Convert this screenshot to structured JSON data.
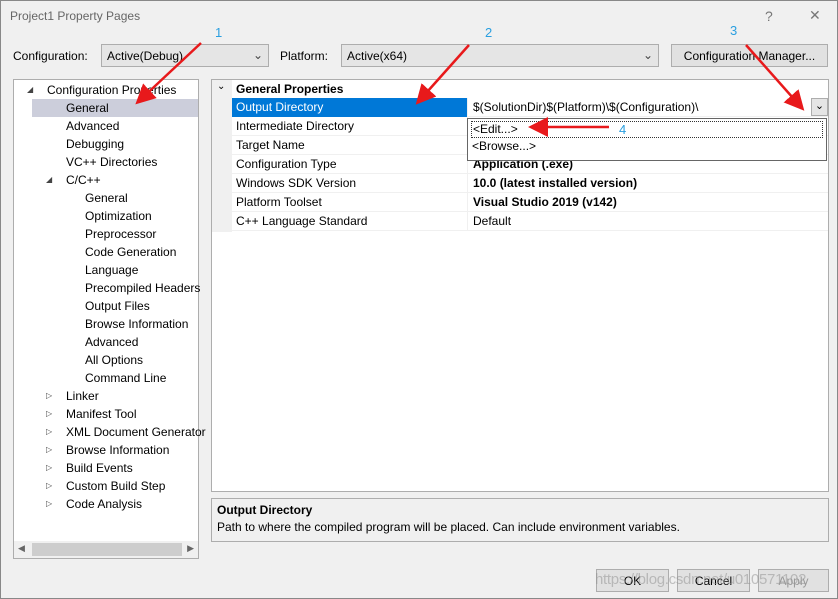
{
  "window": {
    "title": "Project1 Property Pages",
    "help": "?",
    "close": "✕"
  },
  "toolbar": {
    "configuration_label": "Configuration:",
    "configuration_value": "Active(Debug)",
    "platform_label": "Platform:",
    "platform_value": "Active(x64)",
    "config_manager": "Configuration Manager..."
  },
  "tree": [
    {
      "label": "Configuration Properties",
      "level": 0,
      "expanded": true
    },
    {
      "label": "General",
      "level": 1,
      "selected": true
    },
    {
      "label": "Advanced",
      "level": 1
    },
    {
      "label": "Debugging",
      "level": 1
    },
    {
      "label": "VC++ Directories",
      "level": 1
    },
    {
      "label": "C/C++",
      "level": 1,
      "expanded": true
    },
    {
      "label": "General",
      "level": 2
    },
    {
      "label": "Optimization",
      "level": 2
    },
    {
      "label": "Preprocessor",
      "level": 2
    },
    {
      "label": "Code Generation",
      "level": 2
    },
    {
      "label": "Language",
      "level": 2
    },
    {
      "label": "Precompiled Headers",
      "level": 2
    },
    {
      "label": "Output Files",
      "level": 2
    },
    {
      "label": "Browse Information",
      "level": 2
    },
    {
      "label": "Advanced",
      "level": 2
    },
    {
      "label": "All Options",
      "level": 2
    },
    {
      "label": "Command Line",
      "level": 2
    },
    {
      "label": "Linker",
      "level": 1,
      "expanded": false
    },
    {
      "label": "Manifest Tool",
      "level": 1,
      "expanded": false
    },
    {
      "label": "XML Document Generator",
      "level": 1,
      "expanded": false
    },
    {
      "label": "Browse Information",
      "level": 1,
      "expanded": false
    },
    {
      "label": "Build Events",
      "level": 1,
      "expanded": false
    },
    {
      "label": "Custom Build Step",
      "level": 1,
      "expanded": false
    },
    {
      "label": "Code Analysis",
      "level": 1,
      "expanded": false
    }
  ],
  "grid": {
    "section": "General Properties",
    "rows": [
      {
        "label": "Output Directory",
        "value": "$(SolutionDir)$(Platform)\\$(Configuration)\\",
        "selected": true
      },
      {
        "label": "Intermediate Directory",
        "value": ""
      },
      {
        "label": "Target Name",
        "value": ""
      },
      {
        "label": "Configuration Type",
        "value": "Application (.exe)",
        "bold": true
      },
      {
        "label": "Windows SDK Version",
        "value": "10.0 (latest installed version)",
        "bold": true
      },
      {
        "label": "Platform Toolset",
        "value": "Visual Studio 2019 (v142)",
        "bold": true
      },
      {
        "label": "C++ Language Standard",
        "value": "Default"
      }
    ]
  },
  "dropdown": {
    "items": [
      "<Edit...>",
      "<Browse...>"
    ]
  },
  "description": {
    "title": "Output Directory",
    "text": "Path to where the compiled program will be placed. Can include environment variables."
  },
  "buttons": {
    "ok": "OK",
    "cancel": "Cancel",
    "apply": "Apply"
  },
  "annotations": {
    "n1": "1",
    "n2": "2",
    "n3": "3",
    "n4": "4",
    "color": "#e8191b"
  },
  "watermark": "https://blog.csdn.net/u010571102",
  "colors": {
    "selection": "#0078d7",
    "tree_selection": "#cccedb"
  }
}
